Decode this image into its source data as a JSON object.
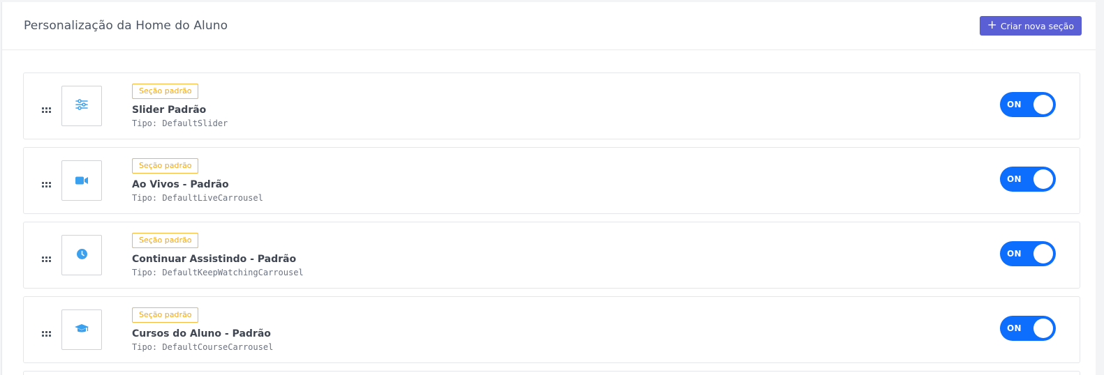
{
  "header": {
    "title": "Personalização da Home do Aluno",
    "create_button_label": "Criar nova seção",
    "create_button_icon": "plus-icon"
  },
  "colors": {
    "accent": "#5a5fd6",
    "toggle_on": "#0d6efd",
    "badge": "#f0a81a",
    "icon": "#3aa0f0"
  },
  "sections": [
    {
      "badge": "Seção padrão",
      "name": "Slider Padrão",
      "type": "Tipo: DefaultSlider",
      "icon": "sliders-icon",
      "toggle_label": "ON",
      "enabled": true
    },
    {
      "badge": "Seção padrão",
      "name": "Ao Vivos - Padrão",
      "type": "Tipo: DefaultLiveCarrousel",
      "icon": "video-camera-icon",
      "toggle_label": "ON",
      "enabled": true
    },
    {
      "badge": "Seção padrão",
      "name": "Continuar Assistindo - Padrão",
      "type": "Tipo: DefaultKeepWatchingCarrousel",
      "icon": "clock-icon",
      "toggle_label": "ON",
      "enabled": true
    },
    {
      "badge": "Seção padrão",
      "name": "Cursos do Aluno - Padrão",
      "type": "Tipo: DefaultCourseCarrousel",
      "icon": "graduation-cap-icon",
      "toggle_label": "ON",
      "enabled": true
    }
  ]
}
